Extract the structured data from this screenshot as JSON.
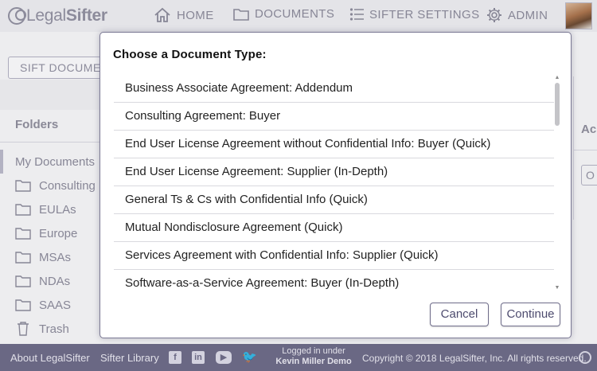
{
  "header": {
    "logo_prefix": "Legal",
    "logo_suffix": "Sifter",
    "nav": [
      {
        "label": "HOME",
        "icon": "home-icon"
      },
      {
        "label": "DOCUMENTS",
        "icon": "folder-icon"
      },
      {
        "label": "SIFTER SETTINGS",
        "icon": "list-settings-icon"
      },
      {
        "label": "ADMIN",
        "icon": "gear-icon"
      }
    ]
  },
  "page": {
    "sift_button_label": "SIFT DOCUMENT",
    "folders_title": "Folders",
    "folders": [
      {
        "label": "My Documents",
        "icon": ""
      },
      {
        "label": "Consulting",
        "icon": "folder-icon"
      },
      {
        "label": "EULAs",
        "icon": "folder-icon"
      },
      {
        "label": "Europe",
        "icon": "folder-icon"
      },
      {
        "label": "MSAs",
        "icon": "folder-icon"
      },
      {
        "label": "NDAs",
        "icon": "folder-icon"
      },
      {
        "label": "SAAS",
        "icon": "folder-icon"
      },
      {
        "label": "Trash",
        "icon": "trash-icon"
      }
    ],
    "right_heading_fragment": "Ac",
    "right_button_fragment": "O"
  },
  "modal": {
    "title": "Choose a Document Type:",
    "options": [
      "Business Associate Agreement: Addendum",
      "Consulting Agreement: Buyer",
      "End User License Agreement without Confidential Info: Buyer (Quick)",
      "End User License Agreement: Supplier (In-Depth)",
      "General Ts & Cs with Confidential Info (Quick)",
      "Mutual Nondisclosure Agreement (Quick)",
      "Services Agreement with Confidential Info: Supplier (Quick)",
      "Software-as-a-Service Agreement: Buyer (In-Depth)"
    ],
    "cancel_label": "Cancel",
    "continue_label": "Continue"
  },
  "footer": {
    "about": "About LegalSifter",
    "library": "Sifter Library",
    "social": [
      "facebook-icon",
      "linkedin-icon",
      "youtube-icon",
      "twitter-icon"
    ],
    "logged_in_label": "Logged in under",
    "logged_in_user": "Kevin Miller Demo",
    "copyright": "Copyright © 2018 LegalSifter, Inc.  All rights reserved."
  },
  "colors": {
    "header_bg": "#e9e9ed",
    "footer_bg": "#6d6b87",
    "modal_border": "#7b7994",
    "button_text": "#4d4b6e"
  }
}
